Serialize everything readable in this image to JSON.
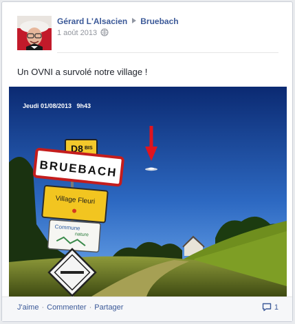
{
  "post": {
    "author": "Gérard L'Alsacien",
    "target": "Bruebach",
    "date": "1 août 2013",
    "privacy_icon": "globe-icon",
    "text": "Un OVNI a survolé notre village !"
  },
  "photo": {
    "timestamp_overlay": "Jeudi 01/08/2013   9h43",
    "sign_main": "BRUEBACH",
    "sign_top": "D8",
    "sign_top_small": "BIS",
    "sign_village_fleuri": "Village Fleuri",
    "sign_commune": "Commune",
    "sign_nature": "nature"
  },
  "actions": {
    "like": "J'aime",
    "comment": "Commenter",
    "share": "Partager",
    "separator": "·",
    "comment_count": "1"
  },
  "colors": {
    "link": "#3b5998",
    "meta": "#90949c",
    "sky_top": "#0d2f7a",
    "sky_bottom": "#4a8ad4",
    "arrow_red": "#e0141e"
  }
}
